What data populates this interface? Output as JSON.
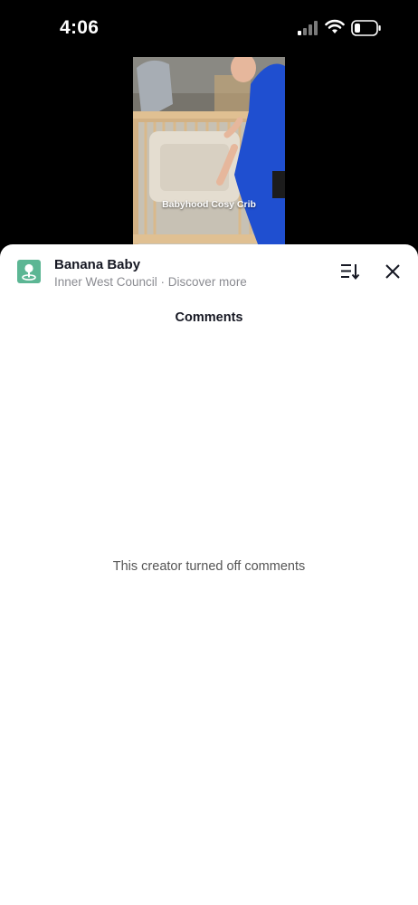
{
  "status_bar": {
    "time": "4:06",
    "icons": [
      "cellular-signal-icon",
      "wifi-icon",
      "battery-icon"
    ]
  },
  "video": {
    "caption": "Babyhood Cosy Crib"
  },
  "place": {
    "name": "Banana Baby",
    "subtitle": "Inner West Council · Discover more",
    "icon": "location-pin-icon",
    "icon_color": "#5cb694"
  },
  "header": {
    "sort_icon": "sort-icon",
    "close_icon": "close-icon"
  },
  "comments": {
    "title": "Comments",
    "empty_message": "This creator turned off comments"
  },
  "colors": {
    "sheet_background": "#ffffff",
    "page_background": "#000000",
    "primary_text": "#161823",
    "secondary_text": "#8a8b91"
  }
}
